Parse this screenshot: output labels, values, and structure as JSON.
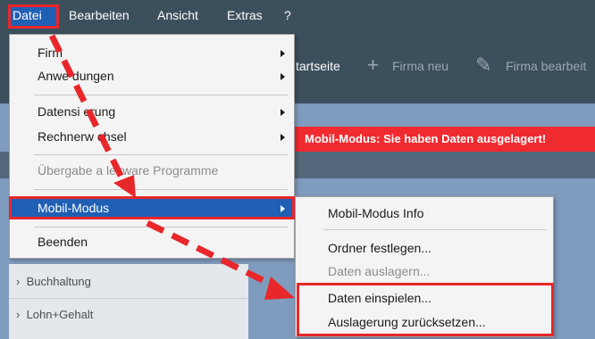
{
  "menubar": {
    "items": [
      {
        "label": "Datei"
      },
      {
        "label": "Bearbeiten"
      },
      {
        "label": "Ansicht"
      },
      {
        "label": "Extras"
      },
      {
        "label": "?"
      }
    ]
  },
  "toolbar": {
    "startseite_label": "tartseite",
    "firma_neu_label": "Firma neu",
    "firma_bearbeiten_label": "Firma bearbeit",
    "plus_icon": "+",
    "pencil_icon": "✎"
  },
  "alert": {
    "text": "Mobil-Modus: Sie haben Daten ausgelagert!"
  },
  "sidebar": {
    "items": [
      {
        "label": "Buchhaltung",
        "chevron": "›"
      },
      {
        "label": "Lohn+Gehalt",
        "chevron": "›"
      }
    ]
  },
  "datei_menu": {
    "items": [
      {
        "label": "Firm",
        "has_submenu": true
      },
      {
        "label": "Anwe   dungen",
        "has_submenu": true
      },
      {
        "label": "Datensi   erung",
        "has_submenu": true
      },
      {
        "label": "Rechnerw   chsel",
        "has_submenu": true
      },
      {
        "label": "Übergabe a   lexware Programme",
        "disabled": true
      },
      {
        "label": "Mobil-Modus",
        "has_submenu": true,
        "selected": true
      },
      {
        "label": "Beenden"
      }
    ]
  },
  "mobil_submenu": {
    "items": [
      {
        "label": "Mobil-Modus Info"
      },
      {
        "label": "Ordner festlegen..."
      },
      {
        "label": "Daten auslagern...",
        "disabled": true
      },
      {
        "label": "Daten einspielen..."
      },
      {
        "label": "Auslagerung zurücksetzen..."
      }
    ]
  },
  "colors": {
    "accent": "#e8272b",
    "selection": "#1f5fb4",
    "menubar": "#3c4f5d",
    "workarea": "#7f9bbd",
    "alert": "#f02b30"
  }
}
